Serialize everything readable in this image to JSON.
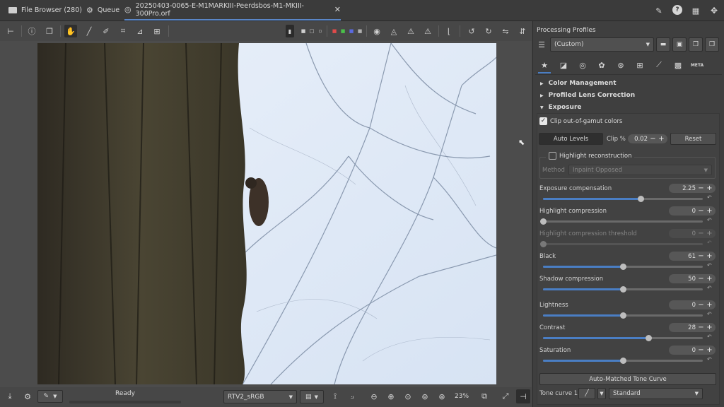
{
  "tabs": [
    {
      "label": "File Browser (280)",
      "icon": "folder-icon"
    },
    {
      "label": "Queue",
      "icon": "gears-icon"
    },
    {
      "label": "20250403-0065-E-M1MARKIII-Peerdsbos-M1-MKIII-300Pro.orf",
      "icon": "aperture-icon",
      "close": "✕"
    }
  ],
  "status": {
    "text": "Ready"
  },
  "bottom": {
    "profile": "RTV2_sRGB",
    "zoom": "23%"
  },
  "right": {
    "header": "Processing Profiles",
    "profile_value": "(Custom)",
    "sections": {
      "color_management": "Color Management",
      "lens_correction": "Profiled Lens Correction",
      "exposure": "Exposure"
    },
    "clip_gamut": {
      "label": "Clip out-of-gamut colors",
      "checked": true
    },
    "auto_levels": "Auto Levels",
    "clip_label": "Clip %",
    "clip_value": "0.02",
    "reset": "Reset",
    "highlight_recon": {
      "label": "Highlight reconstruction",
      "checked": false
    },
    "method_label": "Method",
    "method_value": "Inpaint Opposed",
    "sliders": [
      {
        "label": "Exposure compensation",
        "value": "2.25",
        "fraction": 0.61
      },
      {
        "label": "Highlight compression",
        "value": "0",
        "fraction": 0.0
      },
      {
        "label": "Highlight compression threshold",
        "value": "0",
        "fraction": 0.0,
        "disabled": true
      },
      {
        "label": "Black",
        "value": "61",
        "fraction": 0.5
      },
      {
        "label": "Shadow compression",
        "value": "50",
        "fraction": 0.5
      },
      {
        "label": "Lightness",
        "value": "0",
        "fraction": 0.5
      },
      {
        "label": "Contrast",
        "value": "28",
        "fraction": 0.66
      },
      {
        "label": "Saturation",
        "value": "0",
        "fraction": 0.5
      }
    ],
    "tone_curve_button": "Auto-Matched Tone Curve",
    "tone_curve_label": "Tone curve 1:",
    "tone_curve_value": "Standard"
  },
  "colors": {
    "accent": "#4a7ec4",
    "panel": "#3f3f3f"
  }
}
